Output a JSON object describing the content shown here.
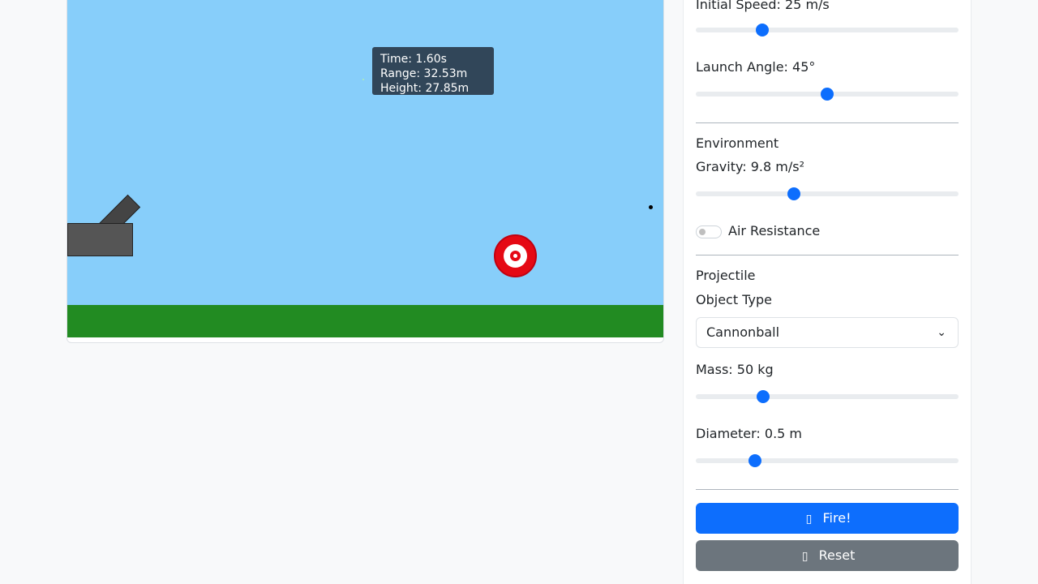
{
  "simulation": {
    "info": {
      "time": "Time: 1.60s",
      "range": "Range: 32.53m",
      "height": "Height: 27.85m"
    }
  },
  "controls": {
    "initial_speed": {
      "label": "Initial Speed: 25 m/s",
      "value": 25
    },
    "launch_angle": {
      "label": "Launch Angle: 45°",
      "value": 45
    },
    "environment_heading": "Environment",
    "gravity": {
      "label": "Gravity: 9.8 m/s²",
      "value": 9.8
    },
    "air_resistance": {
      "label": "Air Resistance",
      "enabled": false
    },
    "projectile_heading": "Projectile",
    "object_type": {
      "label": "Object Type",
      "selected": "Cannonball"
    },
    "mass": {
      "label": "Mass: 50 kg",
      "value": 50
    },
    "diameter": {
      "label": "Diameter: 0.5 m",
      "value": 0.5
    },
    "fire_button": {
      "label": "Fire!",
      "icon": "rocket-icon"
    },
    "reset_button": {
      "label": "Reset",
      "icon": "reset-icon"
    }
  },
  "colors": {
    "sky": "#87cefa",
    "ground": "#228b22",
    "target": "#e50914",
    "primary": "#0d6efd",
    "secondary": "#6c757d"
  }
}
